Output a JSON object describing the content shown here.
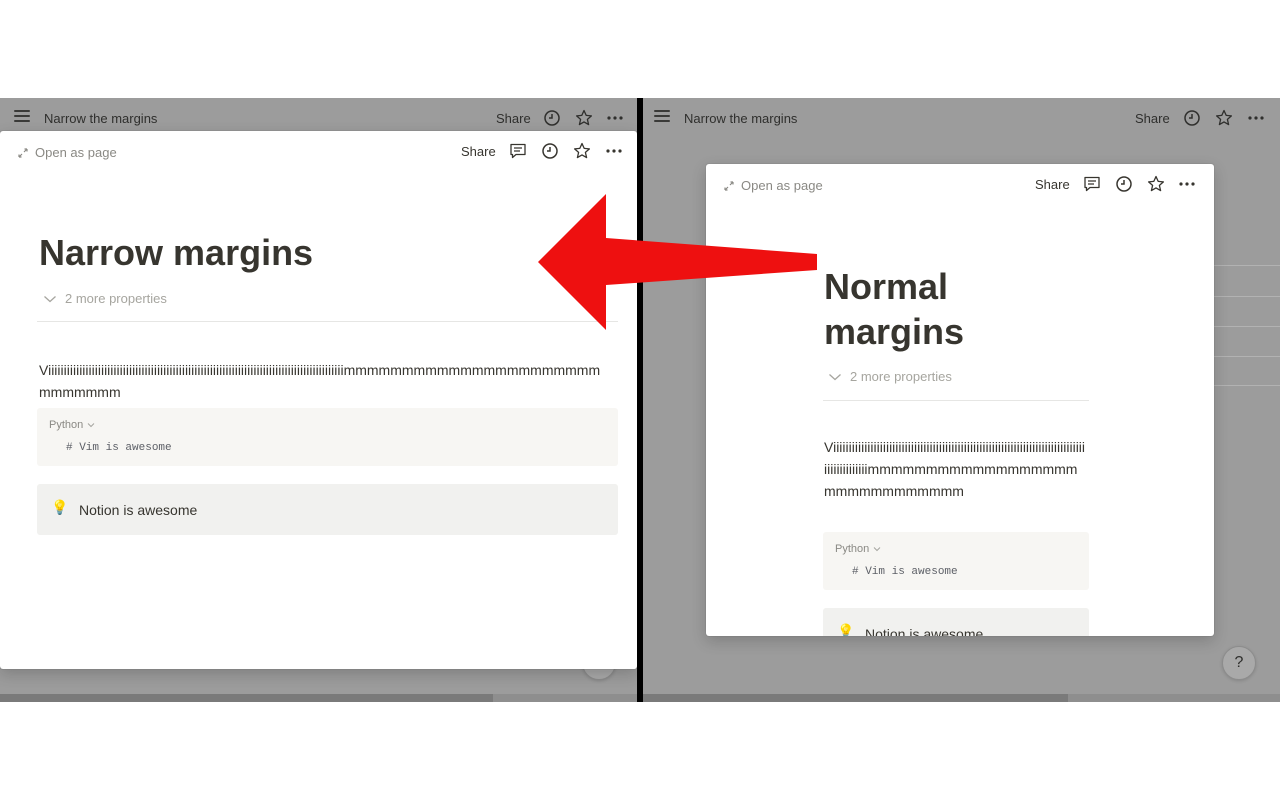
{
  "left_window": {
    "topbar": {
      "title": "Narrow the margins",
      "share_label": "Share"
    },
    "peek": {
      "open_as_page_label": "Open as page",
      "share_label": "Share",
      "page_title": "Narrow margins",
      "properties_toggle_label": "2 more properties",
      "body_text": "Viiiiiiiiiiiiiiiiiiiiiiiiiiiiiiiiiiiiiiiiiiiiiiiiiiiiiiiiiiiiiiiiiiiiiiiiiiiiiiiiiiiiiiiiiiiiiiimmmmmmmmmmmmmmmmmmmmmmmmmmmmm",
      "code_block": {
        "language": "Python",
        "code": "# Vim is awesome"
      },
      "callout": {
        "icon": "lightbulb-icon",
        "text": "Notion is awesome"
      }
    }
  },
  "right_window": {
    "topbar": {
      "title": "Narrow the margins",
      "share_label": "Share"
    },
    "peek": {
      "open_as_page_label": "Open as page",
      "share_label": "Share",
      "page_title": "Normal margins",
      "properties_toggle_label": "2 more properties",
      "body_text": "Viiiiiiiiiiiiiiiiiiiiiiiiiiiiiiiiiiiiiiiiiiiiiiiiiiiiiiiiiiiiiiiiiiiiiiiiiiiiiiiiiiiiiiiiiiiiiiimmmmmmmmmmmmmmmmmmmmmmmmmmmmmm",
      "code_block": {
        "language": "Python",
        "code": "# Vim is awesome"
      },
      "callout": {
        "icon": "lightbulb-icon",
        "text": "Notion is awesome"
      }
    },
    "help_button_label": "?"
  },
  "colors": {
    "overlay": "#9c9c9c",
    "arrow": "#ee1010",
    "divider": "#000000",
    "text": "#37352f",
    "muted": "#8a8984"
  }
}
